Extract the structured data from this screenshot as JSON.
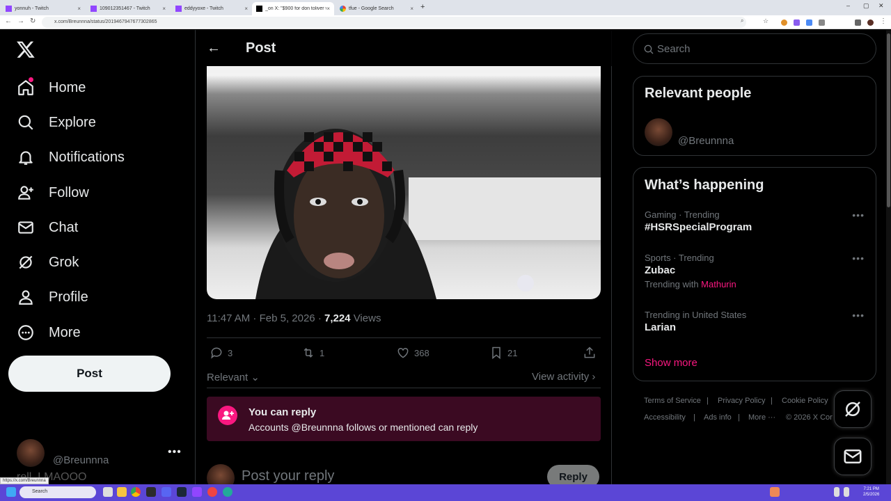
{
  "browser": {
    "tabs": [
      {
        "label": "yonnuh - Twitch",
        "active": false
      },
      {
        "label": "109012351467 - Twitch",
        "active": false
      },
      {
        "label": "eddyyoxe - Twitch",
        "active": false
      },
      {
        "label": "_on X: \"$900 for don toliver vip",
        "active": true
      },
      {
        "label": "tfue - Google Search",
        "active": false
      }
    ],
    "new_tab": "+",
    "url": "x.com/Breunnna/status/2019467947677302865"
  },
  "leftnav": {
    "items": [
      {
        "label": "Home",
        "icon": "home-icon"
      },
      {
        "label": "Explore",
        "icon": "search-icon"
      },
      {
        "label": "Notifications",
        "icon": "bell-icon"
      },
      {
        "label": "Follow",
        "icon": "follow-icon"
      },
      {
        "label": "Chat",
        "icon": "mail-icon"
      },
      {
        "label": "Grok",
        "icon": "grok-icon"
      },
      {
        "label": "Profile",
        "icon": "person-icon"
      },
      {
        "label": "More",
        "icon": "more-circle-icon"
      }
    ],
    "post_label": "Post",
    "account": {
      "handle": "@Breunnna",
      "more": "•••",
      "below_name": "rell_LMAOOO"
    },
    "status_url": "https://x.com/Breunnna"
  },
  "main": {
    "title": "Post",
    "timestamp": "11:47 AM · Feb 5, 2026 · ",
    "views_count": "7,224",
    "views_label": " Views",
    "actions": {
      "replies": "3",
      "reposts": "1",
      "likes": "368",
      "bookmarks": "21"
    },
    "sort_label": "Relevant",
    "view_activity": "View activity",
    "reply_notice": {
      "title": "You can reply",
      "subtitle": "Accounts @Breunnna follows or mentioned can reply"
    },
    "composer_placeholder": "Post your reply",
    "reply_button": "Reply"
  },
  "right": {
    "search_placeholder": "Search",
    "relevant_people": {
      "title": "Relevant people",
      "handle": "@Breunnna"
    },
    "whats_happening": {
      "title": "What’s happening",
      "trends": [
        {
          "context": "Gaming · Trending",
          "name": "#HSRSpecialProgram",
          "with_label": "",
          "with_name": ""
        },
        {
          "context": "Sports · Trending",
          "name": "Zubac",
          "with_label": "Trending with ",
          "with_name": "Mathurin"
        },
        {
          "context": "Trending in United States",
          "name": "Larian",
          "with_label": "",
          "with_name": ""
        }
      ],
      "show_more": "Show more"
    },
    "footer": {
      "terms": "Terms of Service",
      "privacy": "Privacy Policy",
      "cookie": "Cookie Policy",
      "accessibility": "Accessibility",
      "ads": "Ads info",
      "more": "More ···",
      "copyright": "© 2026 X Cor"
    }
  },
  "taskbar": {
    "search_placeholder": "Search",
    "time": "7:21 PM",
    "date": "2/5/2026"
  },
  "colors": {
    "accent": "#f91880",
    "background": "#000000",
    "muted": "#71767b",
    "taskbar": "#5b46d6"
  }
}
